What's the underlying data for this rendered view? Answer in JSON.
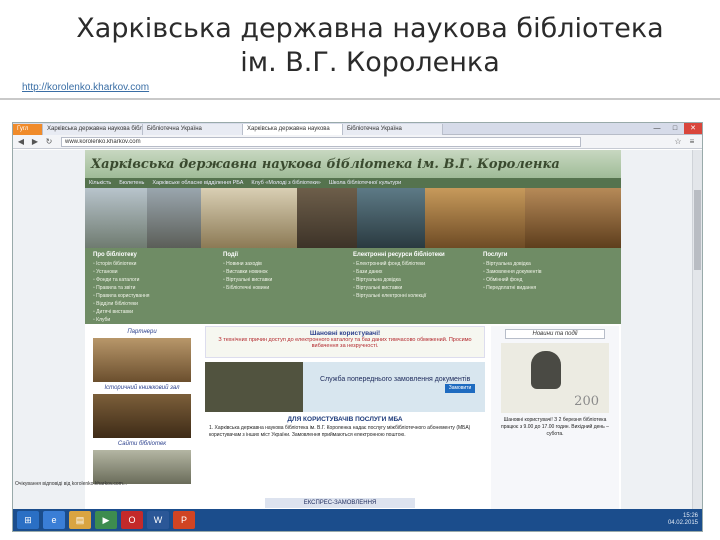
{
  "slide": {
    "title": "Харківська державна наукова бібліотека ім. В.Г. Короленка",
    "url": "http://korolenko.kharkov.com"
  },
  "browser": {
    "tabs": [
      "Гугл",
      "Харківська державна наукова бібл...",
      "Бібліотечна Україна",
      "Харківська державна наукова",
      "Бібліотечна Україна"
    ],
    "address": "www.korolenko.kharkov.com",
    "window_buttons": [
      "—",
      "□",
      "✕"
    ]
  },
  "site": {
    "title": "Харківська державна наукова бібліотека ім. В.Г. Короленка",
    "nav": [
      "Кількість",
      "Бюлетень",
      "Харківське обласне відділення РБА",
      "Клуб «Молоді з бібліотеки»",
      "Школа бібліотечної культури"
    ],
    "menu": [
      {
        "title": "Про бібліотеку",
        "items": [
          "Історія бібліотеки",
          "Установи",
          "Фонди та каталоги",
          "Правила та звіти",
          "Правила користування",
          "Відділи бібліотеки",
          "Дитячі виставки",
          "Клуби"
        ]
      },
      {
        "title": "Події",
        "items": [
          "Новини заходів",
          "Виставки новинок",
          "Віртуальні виставки",
          "Бібліотечні новини"
        ]
      },
      {
        "title": "Електронні ресурси бібліотеки",
        "items": [
          "Електронний фонд бібліотеки",
          "Бази даних",
          "Віртуальна довідка",
          "Віртуальні виставки",
          "Віртуальні електронні колекції"
        ]
      },
      {
        "title": "Послуги",
        "items": [
          "Віртуальна довідка",
          "Замовлення документів",
          "Обмінний фонд",
          "Передплатні видання"
        ]
      }
    ],
    "left_labels": [
      "Партнери",
      "Історичний книжковий зал",
      "Сайти бібліотек"
    ],
    "notice_header": "Шановні користувачі!",
    "notice_text": "З технічних причин доступ до електронного каталогу та баз даних тимчасово обмежений. Просимо вибачення за незручності.",
    "service_text": "Служба попереднього замовлення документів",
    "service_button": "Замовити",
    "mba_header": "ДЛЯ КОРИСТУВАЧІВ ПОСЛУГИ МБА",
    "mba_text": "1. Харківська державна наукова бібліотека ім. В.Г. Короленка надає послугу міжбібліотечного абонементу (МБА) користувачам з інших міст України. Замовлення приймаються електронною поштою.",
    "express": "ЕКСПРЕС-ЗАМОВЛЕННЯ",
    "news_header": "Новини та події",
    "news_200": "200",
    "news_text": "Шановні користувачі! З 2 березня бібліотека працює з 9.00 до 17.00 годин. Вихідний день – субота."
  },
  "status_bar": "Очікування відповіді від korolenko.kharkov.com...",
  "taskbar": {
    "time": "15:26",
    "date": "04.02.2015"
  }
}
